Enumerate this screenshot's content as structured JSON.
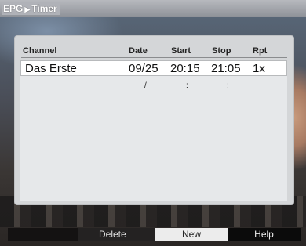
{
  "breadcrumb": {
    "section": "EPG",
    "page": "Timer",
    "separator": "▶"
  },
  "columns": {
    "channel": "Channel",
    "date": "Date",
    "start": "Start",
    "stop": "Stop",
    "repeat": "Rpt"
  },
  "rows": [
    {
      "channel": "Das Erste",
      "date": "09/25",
      "start": "20:15",
      "stop": "21:05",
      "repeat": "1x"
    }
  ],
  "empty_row": {
    "date_sep": "/",
    "time_sep": ":"
  },
  "footer": {
    "red": "Delete",
    "white": "New",
    "black": "Help"
  }
}
